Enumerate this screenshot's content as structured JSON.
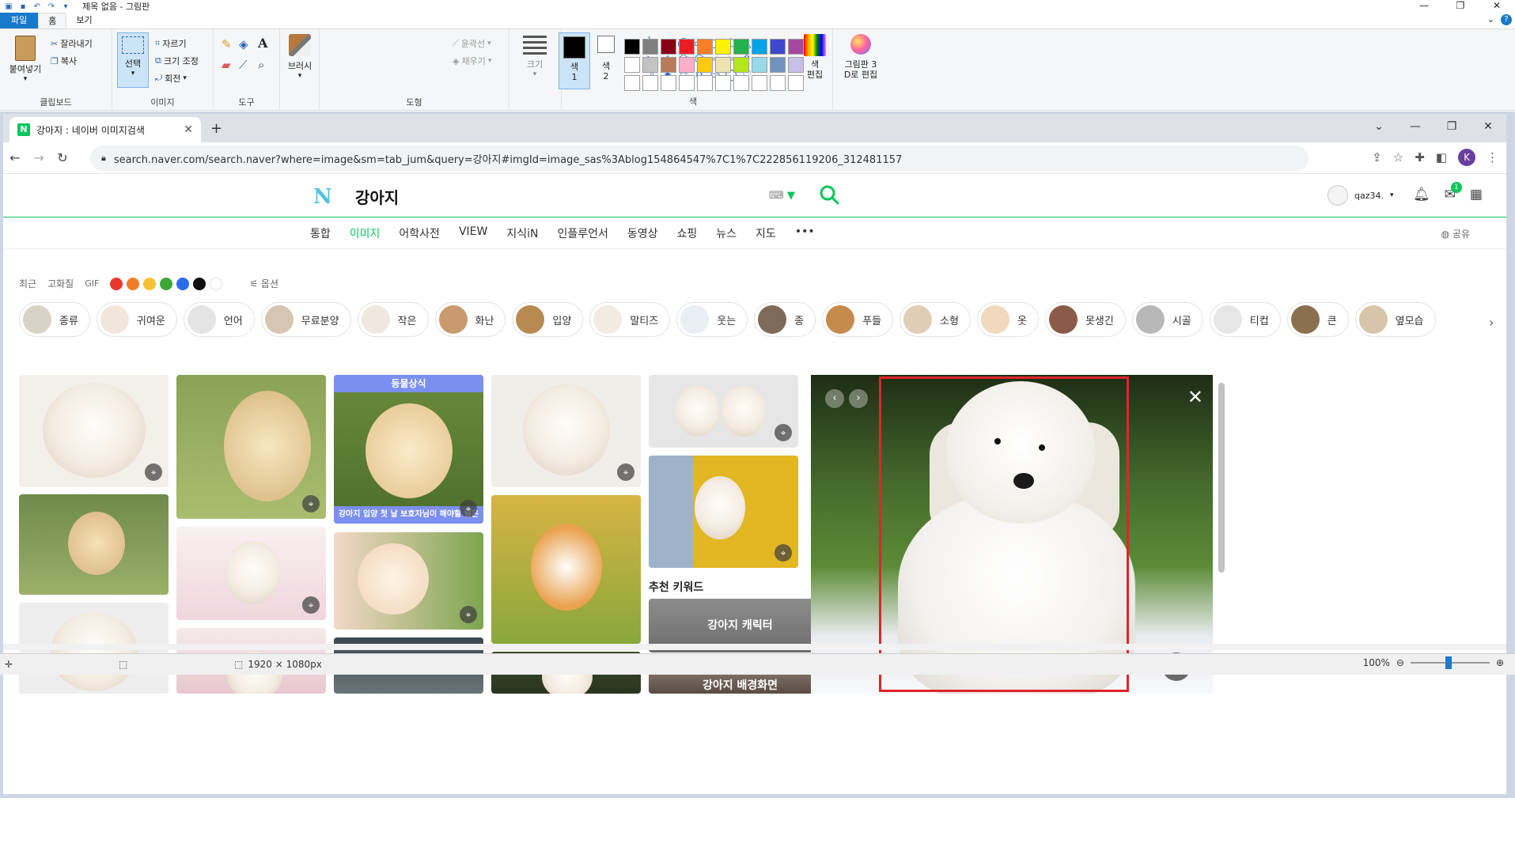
{
  "paint": {
    "window_title": "제목 없음 - 그림판",
    "tabs": [
      "파일",
      "홈",
      "보기"
    ],
    "clipboard": {
      "paste": "붙여넣기",
      "cut": "잘라내기",
      "copy": "복사",
      "label": "클립보드"
    },
    "image": {
      "select": "선택",
      "crop": "자르기",
      "resize": "크기 조정",
      "rotate": "회전",
      "label": "이미지"
    },
    "tools": {
      "label": "도구"
    },
    "brushes": "브러시",
    "shapes": {
      "outline": "윤곽선",
      "fill": "채우기",
      "label": "도형"
    },
    "size": "크기",
    "color1": "색\n1",
    "color2": "색\n2",
    "edit_colors": "색\n편집",
    "paint3d": "그림판 3\nD로 편집",
    "colors_label": "색",
    "palette": [
      "#000000",
      "#7f7f7f",
      "#880015",
      "#ed1c24",
      "#ff7f27",
      "#fff200",
      "#22b14c",
      "#00a2e8",
      "#3f48cc",
      "#a349a4",
      "#ffffff",
      "#c3c3c3",
      "#b97a57",
      "#ffaec9",
      "#ffc90e",
      "#efe4b0",
      "#b5e61d",
      "#99d9ea",
      "#7092be",
      "#c8bfe7",
      "#ffffff",
      "#ffffff",
      "#ffffff",
      "#ffffff",
      "#ffffff",
      "#ffffff",
      "#ffffff",
      "#ffffff",
      "#ffffff",
      "#ffffff"
    ],
    "status": {
      "dimensions": "1920 × 1080px",
      "zoom": "100%"
    }
  },
  "browser": {
    "tab_title": "강아지 : 네이버 이미지검색",
    "favicon": "N",
    "url": "search.naver.com/search.naver?where=image&sm=tab_jum&query=강아지#imgId=image_sas%3Ablog154864547%7C1%7C222856119206_312481157",
    "profile_initial": "K"
  },
  "naver": {
    "query": "강아지",
    "user": "qaz34.",
    "mail_count": "1",
    "tabs": [
      "통합",
      "이미지",
      "어학사전",
      "VIEW",
      "지식iN",
      "인플루언서",
      "동영상",
      "쇼핑",
      "뉴스",
      "지도",
      "•••"
    ],
    "active_tab": "이미지",
    "share": "공유",
    "filters": [
      "최근",
      "고화질",
      "GIF"
    ],
    "options": "옵션",
    "filter_colors": [
      "#e8372c",
      "#f27b25",
      "#f6c234",
      "#3da639",
      "#2b6ce8",
      "#111111",
      "#ffffff"
    ],
    "chips": [
      "종류",
      "귀여운",
      "언어",
      "무료분양",
      "작은",
      "화난",
      "입양",
      "말티즈",
      "웃는",
      "종",
      "푸들",
      "소형",
      "옷",
      "못생긴",
      "시골",
      "티컵",
      "큰",
      "옆모습"
    ],
    "banner_top": "동물상식",
    "banner_bottom": "강아지 입양 첫 날 보호자님이 해야할 일은",
    "recommend_title": "추천 키워드",
    "recommend": [
      "강아지 캐릭터",
      "강아지 배경화면"
    ]
  }
}
